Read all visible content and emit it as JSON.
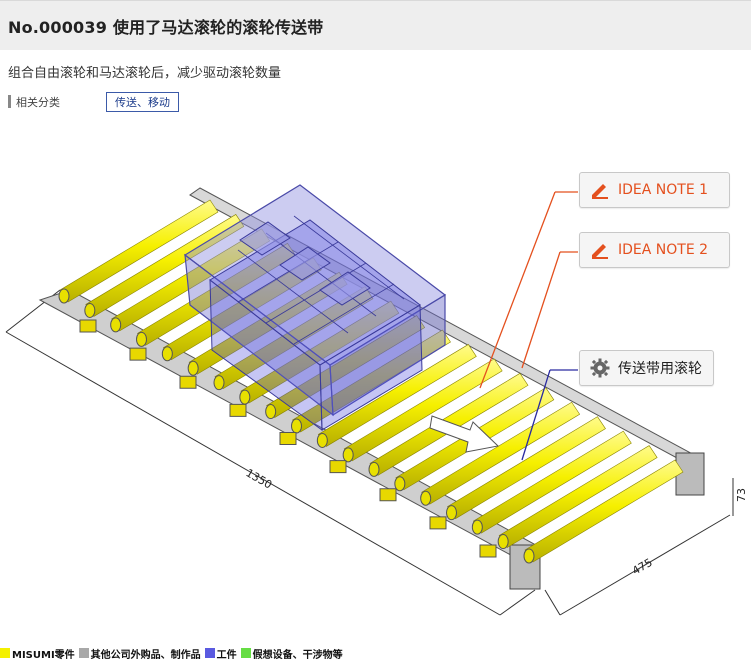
{
  "header": {
    "title": "No.000039 使用了马达滚轮的滚轮传送带"
  },
  "description": "组合自由滚轮和马达滚轮后，减少驱动滚轮数量",
  "category": {
    "label": "相关分类",
    "tag": "传送、移动"
  },
  "notes": [
    {
      "label": "IDEA NOTE 1",
      "icon": "pencil-icon"
    },
    {
      "label": "IDEA NOTE 2",
      "icon": "pencil-icon"
    },
    {
      "label": "传送带用滚轮",
      "icon": "gear-icon"
    }
  ],
  "dimensions": {
    "length": "1350",
    "width": "475",
    "height": "73"
  },
  "legend": [
    {
      "label": "MISUMI零件",
      "color": "#f4f000"
    },
    {
      "label": "其他公司外购品、制作品",
      "color": "#a8a8a8"
    },
    {
      "label": "工件",
      "color": "#5a5ae0"
    },
    {
      "label": "假想设备、干涉物等",
      "color": "#66dd44"
    }
  ],
  "colors": {
    "roller": "#f6f000",
    "idea_accent": "#e4501e",
    "workpiece": "#6b6bd8"
  }
}
